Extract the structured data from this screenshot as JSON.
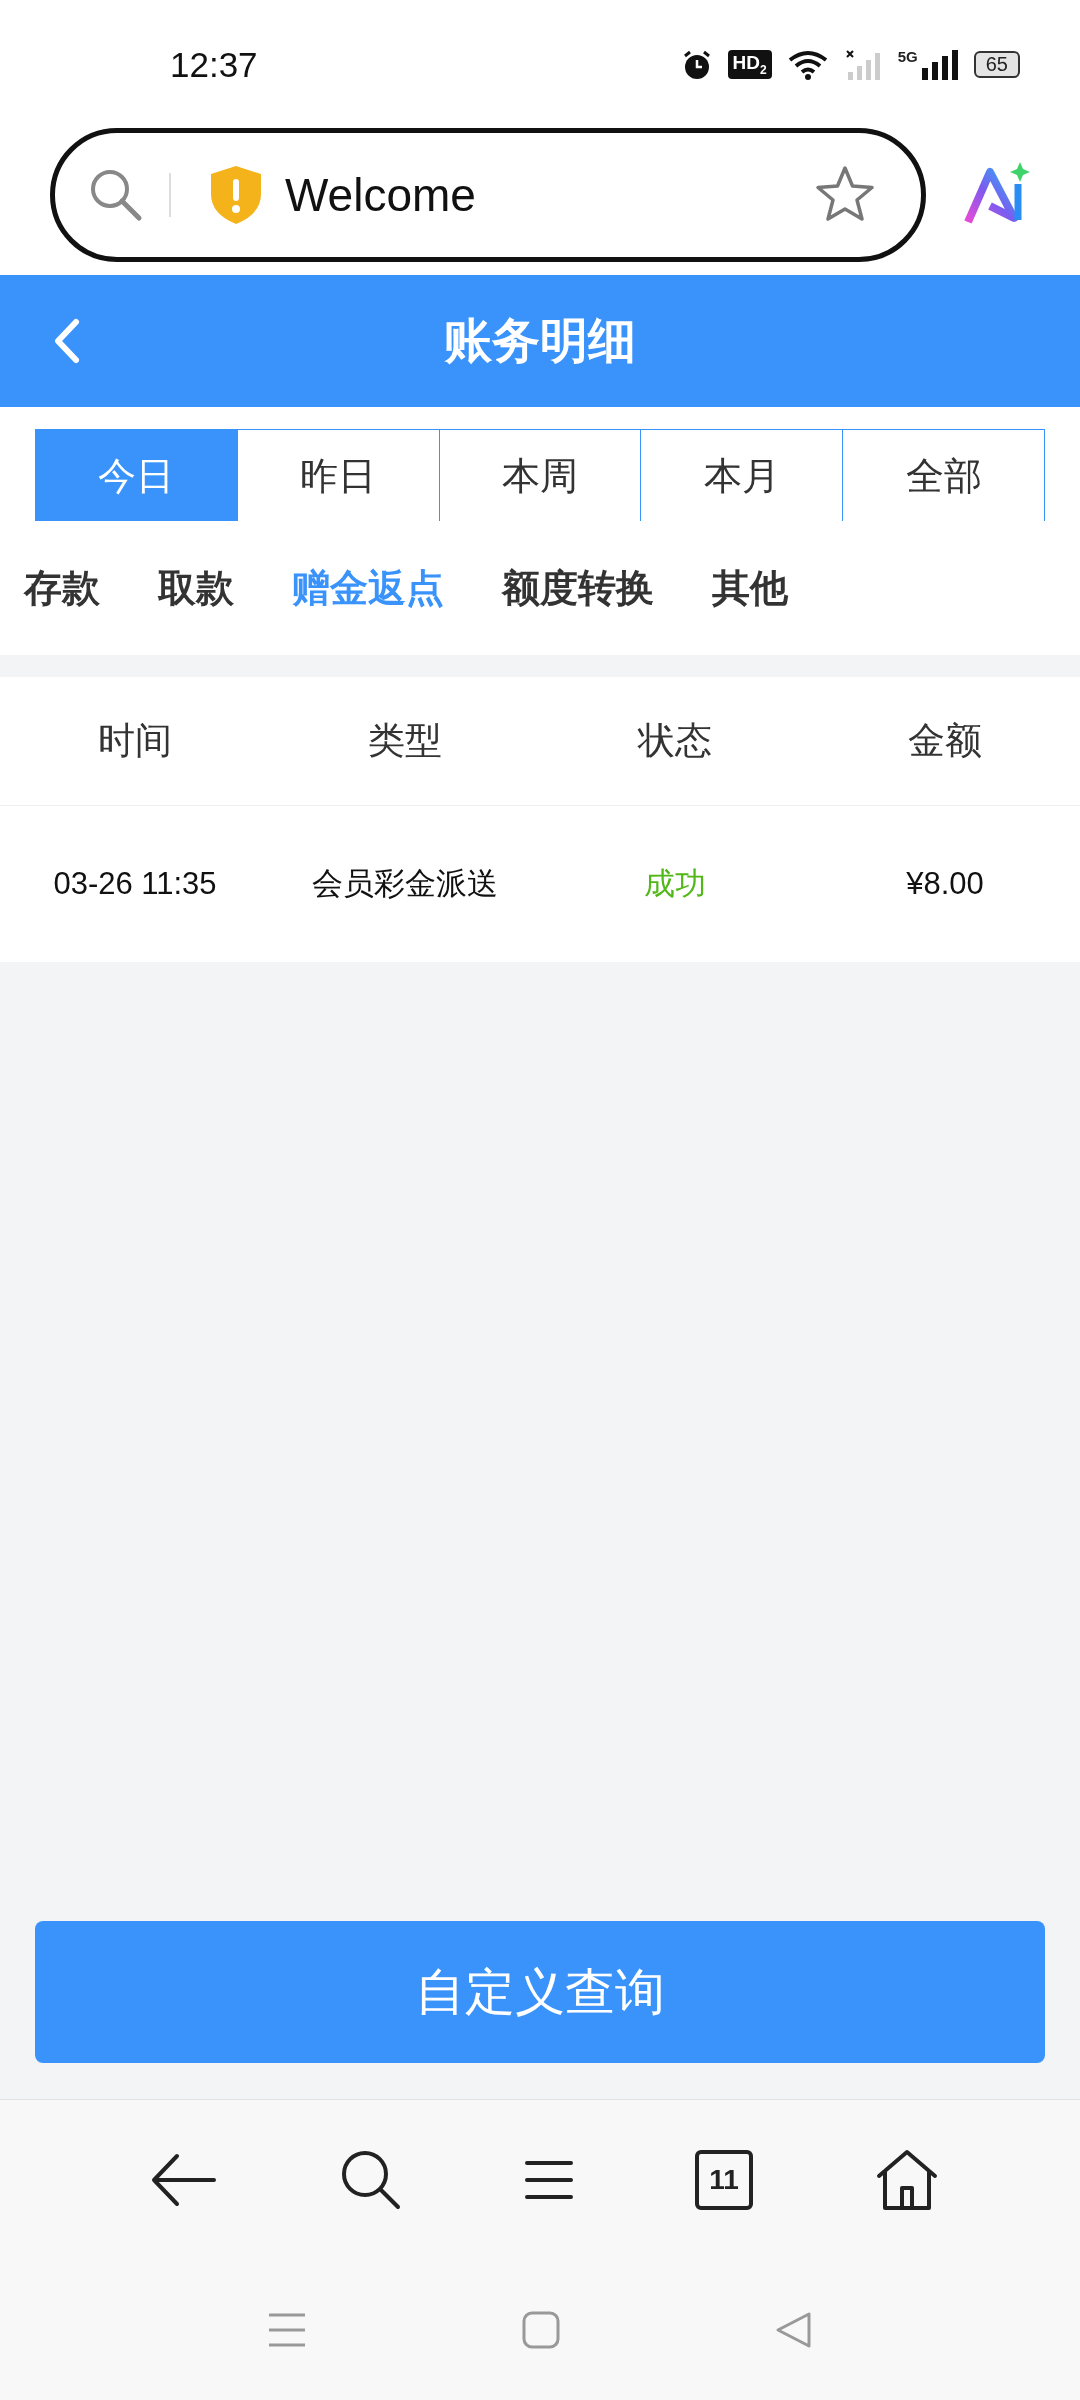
{
  "status_bar": {
    "time": "12:37",
    "hd_badge": "HD$_{2}$",
    "network": "5G",
    "battery": "65"
  },
  "browser": {
    "address": "Welcome"
  },
  "header": {
    "title": "账务明细"
  },
  "date_tabs": [
    {
      "label": "今日",
      "selected": true
    },
    {
      "label": "昨日",
      "selected": false
    },
    {
      "label": "本周",
      "selected": false
    },
    {
      "label": "本月",
      "selected": false
    },
    {
      "label": "全部",
      "selected": false
    }
  ],
  "categories": [
    {
      "label": "存款",
      "selected": false
    },
    {
      "label": "取款",
      "selected": false
    },
    {
      "label": "赠金返点",
      "selected": true
    },
    {
      "label": "额度转换",
      "selected": false
    },
    {
      "label": "其他",
      "selected": false
    }
  ],
  "table": {
    "columns": [
      "时间",
      "类型",
      "状态",
      "金额"
    ],
    "rows": [
      {
        "time": "03-26 11:35",
        "type": "会员彩金派送",
        "status": "成功",
        "color": "#52b81a",
        "amount": "¥8.00"
      }
    ]
  },
  "query_button": "自定义查询",
  "browser_toolbar": {
    "tab_count": "11"
  }
}
